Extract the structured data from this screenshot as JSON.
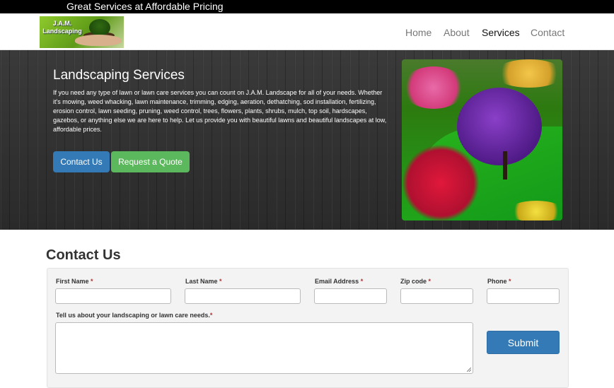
{
  "topbar": {
    "tagline": "Great Services at Affordable Pricing"
  },
  "logo": {
    "text": "J.A.M. Landscaping"
  },
  "nav": [
    {
      "label": "Home"
    },
    {
      "label": "About"
    },
    {
      "label": "Services"
    },
    {
      "label": "Contact"
    }
  ],
  "nav_active": "Services",
  "hero": {
    "title": "Landscaping Services",
    "body": "If you need any type of lawn or lawn care services you can count on J.A.M. Landscape for all of your needs. Whether it's mowing, weed whacking, lawn maintenance, trimming, edging, aeration, dethatching, sod installation, fertilizing, erosion control, lawn seeding, pruning, weed control, trees, flowers, plants, shrubs, mulch, top soil, hardscapes, gazebos, or anything else we are here to help. Let us provide you with beautiful lawns and beautiful landscapes at low, affordable prices.",
    "contact_button": "Contact Us",
    "quote_button": "Request a Quote"
  },
  "contact": {
    "title": "Contact Us",
    "fields": [
      {
        "label": "First Name",
        "value": ""
      },
      {
        "label": "Last Name",
        "value": ""
      },
      {
        "label": "Email Address",
        "value": ""
      },
      {
        "label": "Zip code",
        "value": ""
      },
      {
        "label": "Phone",
        "value": ""
      }
    ],
    "required_mark": "*",
    "needs_label": "Tell us about your landscaping or lawn care needs.",
    "needs_value": "",
    "submit": "Submit"
  },
  "colors": {
    "primary": "#337ab7",
    "success": "#5cb85c",
    "topbar": "#000000"
  }
}
